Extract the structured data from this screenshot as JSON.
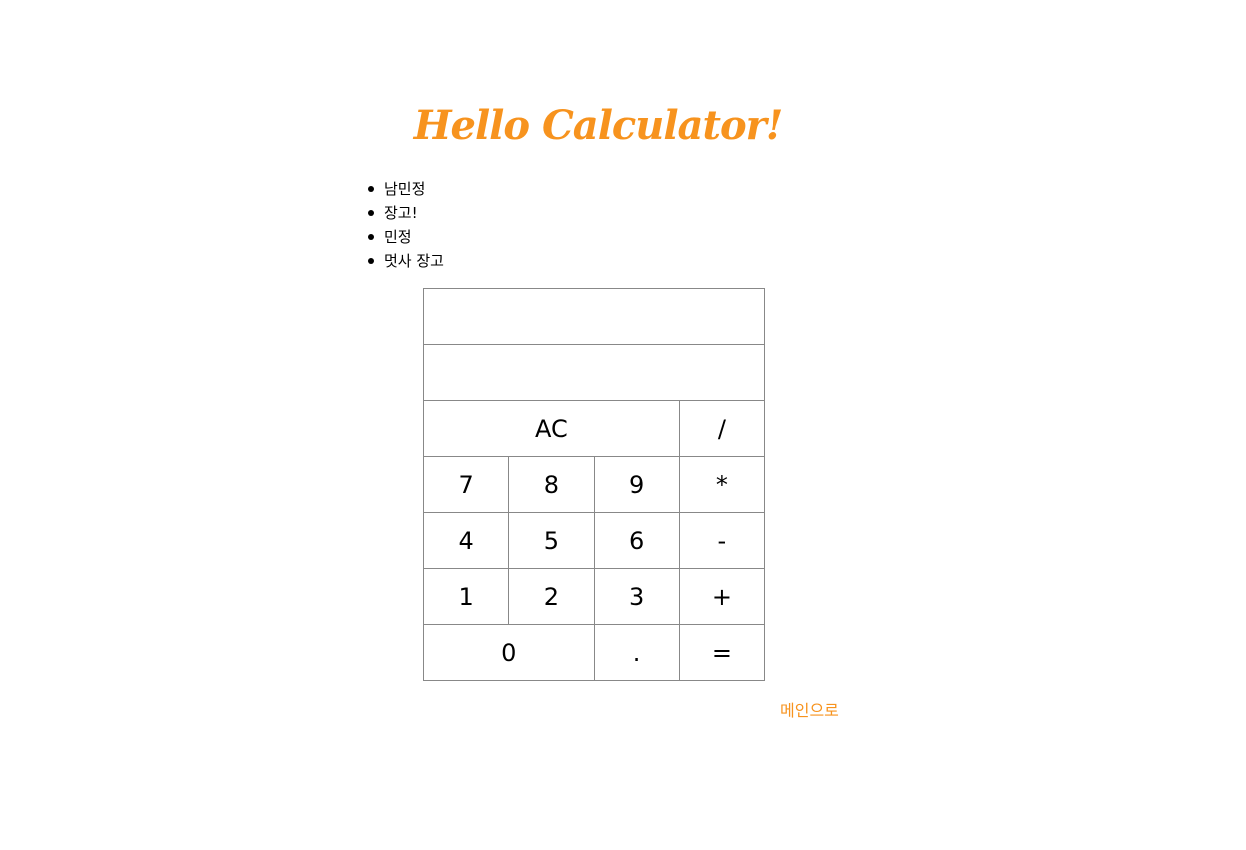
{
  "header": {
    "title": "Hello Calculator!"
  },
  "list": [
    "남민정",
    "장고!",
    "민정",
    "멋사 장고"
  ],
  "calculator": {
    "display_top": "",
    "display_bottom": "",
    "keys": {
      "clear": "AC",
      "divide": "/",
      "seven": "7",
      "eight": "8",
      "nine": "9",
      "multiply": "*",
      "four": "4",
      "five": "5",
      "six": "6",
      "minus": "-",
      "one": "1",
      "two": "2",
      "three": "3",
      "plus": "+",
      "zero": "0",
      "decimal": ".",
      "equals": "="
    }
  },
  "footer": {
    "main_link": "메인으로"
  },
  "colors": {
    "accent": "#f7931e",
    "text": "#000000",
    "border": "#888888"
  }
}
